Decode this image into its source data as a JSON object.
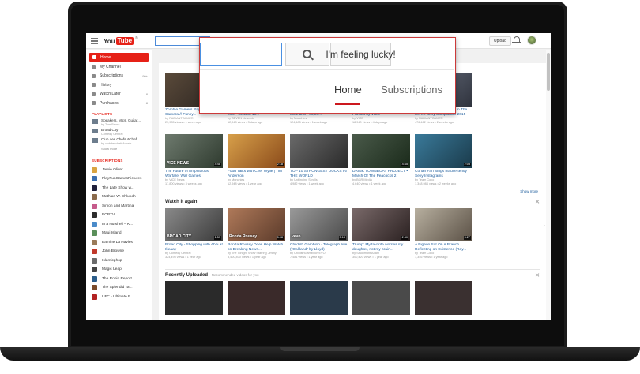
{
  "masthead": {
    "logo_you": "You",
    "logo_tube": "Tube",
    "logo_reg": "®",
    "upload_label": "Upload",
    "icons": [
      "menu-icon",
      "bell-icon",
      "avatar"
    ]
  },
  "sidebar": {
    "nav": [
      {
        "label": "Home",
        "active": true
      },
      {
        "label": "My Channel",
        "count": ""
      },
      {
        "label": "Subscriptions",
        "count": "99+"
      },
      {
        "label": "History",
        "count": ""
      },
      {
        "label": "Watch Later",
        "count": "8"
      },
      {
        "label": "Purchases",
        "count": "8"
      }
    ],
    "playlists_heading": "PLAYLISTS",
    "playlists": [
      {
        "title": "Speakers, Mics, Guitar...",
        "sub": "by Tom Bruno"
      },
      {
        "title": "Broad City",
        "sub": "Comedy Central"
      },
      {
        "title": "Club des Chefs 4Chef...",
        "sub": "by clubdeschefs4chefs"
      }
    ],
    "show_more": "Show more",
    "subscriptions_heading": "SUBSCRIPTIONS",
    "subscriptions": [
      {
        "name": "Jamie Oliver",
        "color": "#d9a441"
      },
      {
        "name": "PlayFunGamesPictures",
        "color": "#3b6fb0"
      },
      {
        "name": "The Late Show w...",
        "color": "#1f1f3a"
      },
      {
        "name": "Mathias W. Ehlundh",
        "color": "#8a6a4c"
      },
      {
        "name": "Simon and Martina",
        "color": "#c65b8b"
      },
      {
        "name": "EOPTV",
        "color": "#2d2d2d"
      },
      {
        "name": "In a Nutshell – K...",
        "color": "#4a8bc9"
      },
      {
        "name": "Maui Island",
        "color": "#5a8f5a"
      },
      {
        "name": "Eamine La Havies",
        "color": "#9a7b5a"
      },
      {
        "name": "John Browne",
        "color": "#c0392b"
      },
      {
        "name": "Islamicphop",
        "color": "#6b6b6b"
      },
      {
        "name": "Magic Leap",
        "color": "#444"
      },
      {
        "name": "The Robin Report",
        "color": "#2c5d8a"
      },
      {
        "name": "The Splendid Ta...",
        "color": "#7a4a2a"
      },
      {
        "name": "UFC - Ultimate F...",
        "color": "#b22222"
      }
    ]
  },
  "rows": [
    {
      "cards": [
        {
          "title": "Zombie Gamers Rage Caught on Camera // Funny...",
          "meta1": "by RADIANTGAMER",
          "meta2": "23,985 views • 1 week ago",
          "dur": "",
          "text": "",
          "bg": "linear-gradient(135deg,#5a4a3a,#2b2420)"
        },
        {
          "title": "Border Security Australia's Front Line - Season 10...",
          "meta1": "by SEVEN Network",
          "meta2": "12,948 views • 3 days ago",
          "dur": "",
          "text": "",
          "bg": "linear-gradient(135deg,#7b8a9a,#3c4a55)"
        },
        {
          "title": "How To Make Paella with George Motz and People...",
          "meta1": "by Munchies",
          "meta2": "124,485 views • 1 week ago",
          "dur": "",
          "text": "",
          "bg": "linear-gradient(135deg,#c89a5a,#7b5a3a)"
        },
        {
          "title": "Meet the Stars of 'Fanding' Profiles by VICE",
          "meta1": "by VICE",
          "meta2": "18,940 views • 4 days ago",
          "dur": "",
          "text": "",
          "bg": "linear-gradient(135deg,#a05a4a,#5a2a2a)"
        },
        {
          "title": "Bitch Throws Should Up In The Act // Funny Compilation 2015",
          "meta1": "by RADIANTGAMER",
          "meta2": "476,462 views • 2 weeks ago",
          "dur": "",
          "text": "",
          "bg": "linear-gradient(135deg,#6a7080,#2f333d)"
        }
      ]
    },
    {
      "cards": [
        {
          "title": "The Future of Amphibious Warfare: War Games",
          "meta1": "by VICE News",
          "meta2": "17,800 views • 3 weeks ago",
          "dur": "4:48",
          "text": "VICE NEWS",
          "bg": "linear-gradient(135deg,#6e7a6e,#2e3a2e)"
        },
        {
          "title": "Food Talks with Chef Wylie | Tim Anderson",
          "meta1": "by Munchies",
          "meta2": "12,948 views • 1 year ago",
          "dur": "2:18",
          "text": "",
          "bg": "linear-gradient(135deg,#d8a04a,#8a4a1a)"
        },
        {
          "title": "TOP 10 STRONGEST DUCKS IN THE WORLD",
          "meta1": "by Unbinding Scrolls",
          "meta2": "4,982 views • 1 week ago",
          "dur": "",
          "text": "",
          "bg": "linear-gradient(135deg,#6a6a6a,#2a2a2a)"
        },
        {
          "title": "DRINK TOWNBOAT PROJECT • March Of The Peacocks 2 (Lesson...",
          "meta1": "by BGR Media",
          "meta2": "4,640 views • 1 week ago",
          "dur": "4:45",
          "text": "",
          "bg": "linear-gradient(135deg,#4a5a4a,#1a2a1a)"
        },
        {
          "title": "Conan Fan Sings Inadvertently Sexy Instagrams",
          "meta1": "by Team Coco",
          "meta2": "1,348,984 views • 2 weeks ago",
          "dur": "2:03",
          "text": "",
          "bg": "linear-gradient(135deg,#3a7a9a,#1a3a4a)"
        }
      ]
    },
    {
      "cards": [
        {
          "title": "Broad City - Shopping with Abbi at Ikeaay",
          "meta1": "by Comedy Central",
          "meta2": "324,495 views • 1 year ago",
          "dur": "1:53",
          "text": "BROAD CITY",
          "bg": "linear-gradient(135deg,#8a8a8a,#3a3a3a)"
        },
        {
          "title": "Ronda Rousey Does Help Watch on Breaking News...",
          "meta1": "by The Tonight Show Starring Jimmy",
          "meta2": "8,400,400 views • 1 year ago",
          "dur": "5:08",
          "text": "Ronda Rousey",
          "bg": "linear-gradient(135deg,#b07a5a,#5a3a2a)"
        },
        {
          "title": "Childish Gambino - Telegraph Ave (\"Oakland\" by Lloyd)",
          "meta1": "by ChildishGambinoVEVO",
          "meta2": "7,481 views • 1 year ago",
          "dur": "5:18",
          "text": "vevo",
          "bg": "linear-gradient(135deg,#9a9a9a,#4a4a4a)"
        },
        {
          "title": "Trump: My favorite worries my daughter, not my brain...",
          "meta1": "by Saudimont Adam",
          "meta2": "300,420 views • 1 year ago",
          "dur": "2:30",
          "text": "",
          "bg": "linear-gradient(135deg,#7a6a6a,#2a2020)"
        },
        {
          "title": "A Pigeon Sat On A Branch Reflecting on Existence (Ray...",
          "meta1": "by Team Coco",
          "meta2": "1,346 views • 1 year ago",
          "dur": "3:27",
          "text": "",
          "bg": "linear-gradient(135deg,#b8b0a0,#5a5045)"
        }
      ]
    }
  ],
  "shelf_watch_again": {
    "title": "Watch it again",
    "close": "✕"
  },
  "shelf_recent": {
    "title": "Recently Uploaded",
    "note": "Recommended videos for you",
    "close": "✕"
  },
  "show_more_link": "Show more",
  "zoom": {
    "lucky_label": "I'm feeling lucky!",
    "tab_home": "Home",
    "tab_subscriptions": "Subscriptions",
    "icons": [
      "search-icon"
    ]
  }
}
